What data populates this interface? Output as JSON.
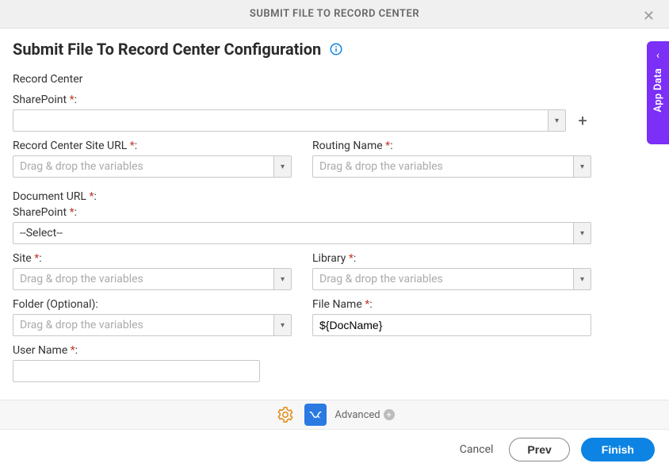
{
  "header": {
    "title": "SUBMIT FILE TO RECORD CENTER"
  },
  "page": {
    "title": "Submit File To Record Center Configuration"
  },
  "sidetab": {
    "label": "App Data"
  },
  "form": {
    "record_center_label": "Record Center",
    "sharepoint_label": "SharePoint",
    "sharepoint_value": "",
    "site_url_label": "Record Center Site URL",
    "site_url_placeholder": "Drag & drop the variables",
    "routing_label": "Routing Name",
    "routing_placeholder": "Drag & drop the variables",
    "doc_url_label": "Document URL",
    "sharepoint2_label": "SharePoint",
    "sharepoint2_value": "--Select--",
    "site_label": "Site",
    "site_placeholder": "Drag & drop the variables",
    "library_label": "Library",
    "library_placeholder": "Drag & drop the variables",
    "folder_label": "Folder (Optional):",
    "folder_placeholder": "Drag & drop the variables",
    "filename_label": "File Name",
    "filename_value": "${DocName}",
    "username_label": "User Name",
    "username_value": ""
  },
  "footer": {
    "advanced_label": "Advanced",
    "cancel": "Cancel",
    "prev": "Prev",
    "finish": "Finish"
  }
}
